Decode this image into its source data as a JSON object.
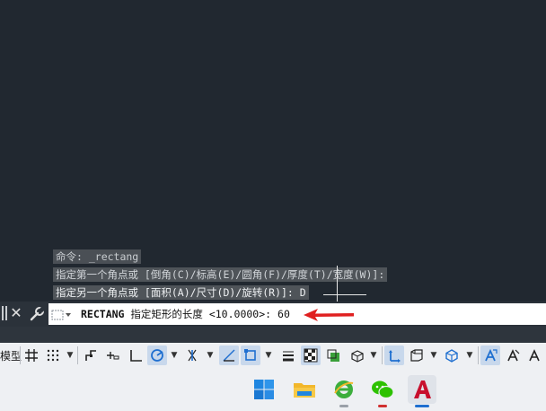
{
  "history": [
    "命令: _rectang",
    "指定第一个角点或 [倒角(C)/标高(E)/圆角(F)/厚度(T)/宽度(W)]:",
    "指定另一个角点或 [面积(A)/尺寸(D)/旋转(R)]: D"
  ],
  "command": {
    "name": "RECTANG",
    "prompt": "指定矩形的长度 <10.0000>:",
    "value": "60"
  },
  "status": {
    "model_label": "模型"
  },
  "colors": {
    "canvas": "#212830",
    "arrow": "#e02020",
    "active_tool": "#1f6fd0",
    "autocad_red": "#c8102e"
  }
}
